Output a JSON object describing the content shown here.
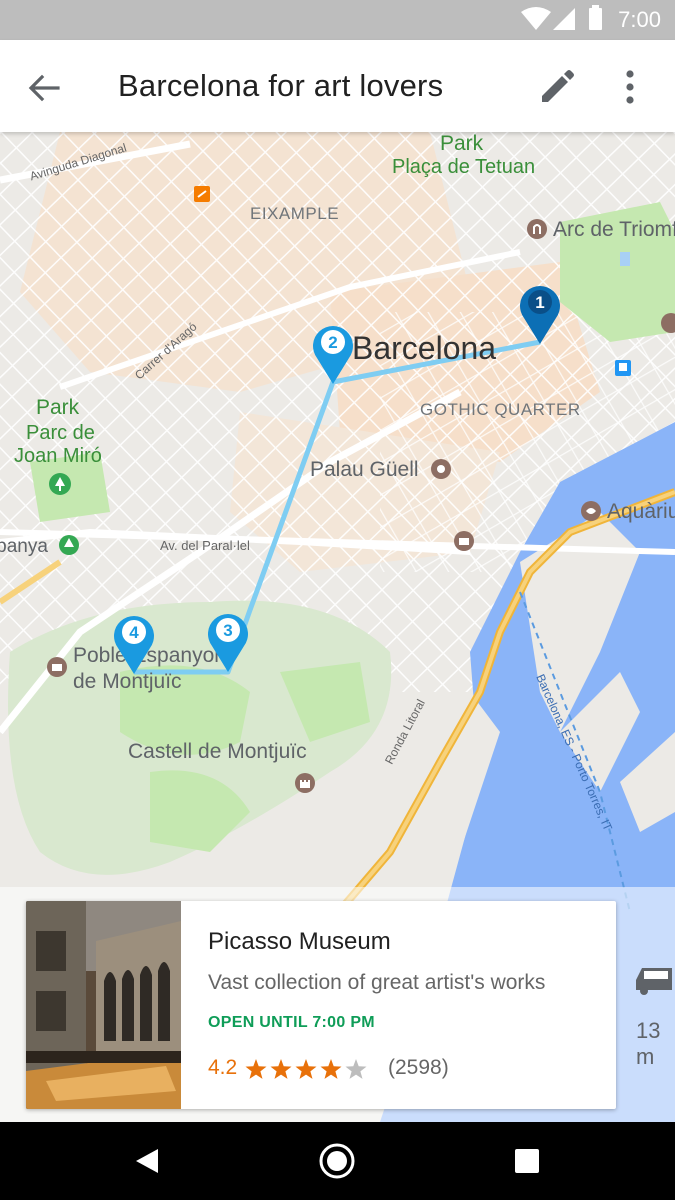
{
  "status_bar": {
    "time": "7:00"
  },
  "app_bar": {
    "title": "Barcelona for art lovers",
    "icons": [
      "arrow-back-icon",
      "edit-pencil-icon",
      "more-vert-icon"
    ]
  },
  "map": {
    "labels": {
      "park_top": "Park",
      "placa_tetuan": "Plaça de Tetuan",
      "avinguda": "Avinguda Diagonal",
      "eixample": "EIXAMPLE",
      "arc": "Arc de Triomf",
      "barcelona": "Barcelona",
      "carrer_arago": "Carrer d'Aragó",
      "gothic": "GOTHIC QUARTER",
      "park_left": "Park",
      "parc_line1": "Parc de",
      "parc_line2": "Joan Miró",
      "palau": "Palau Güell",
      "aquarium": "Aquàrium",
      "espanya": "Espanya",
      "parallel": "Av. del Paral·lel",
      "poble_line1": "Poble Espanyol",
      "poble_line2": "de Montjuïc",
      "castell": "Castell de Montjuïc",
      "ronda": "Ronda Litoral",
      "porto": "Barcelona, ES - Porto Torres, IT"
    },
    "route_stops": [
      {
        "number": "1",
        "state": "selected"
      },
      {
        "number": "2",
        "state": "default"
      },
      {
        "number": "3",
        "state": "default"
      },
      {
        "number": "4",
        "state": "default"
      }
    ],
    "colors": {
      "route": "#7fcdf2",
      "pin": "#1a9ae0",
      "pin_selected": "#0c6fb5",
      "water": "#8ab4f8",
      "park": "#c5e8b0",
      "highway": "#f5c45e"
    }
  },
  "place_card": {
    "title": "Picasso Museum",
    "description": "Vast collection of great artist's works",
    "hours": "OPEN UNTIL 7:00 PM",
    "rating": "4.2",
    "stars_filled": 4,
    "stars_total": 5,
    "reviews": "(2598)"
  },
  "next_card_peek": {
    "text": "13 m",
    "icon": "car-icon"
  },
  "nav_bar": {
    "icons": [
      "back-triangle-icon",
      "home-circle-icon",
      "recents-square-icon"
    ]
  }
}
